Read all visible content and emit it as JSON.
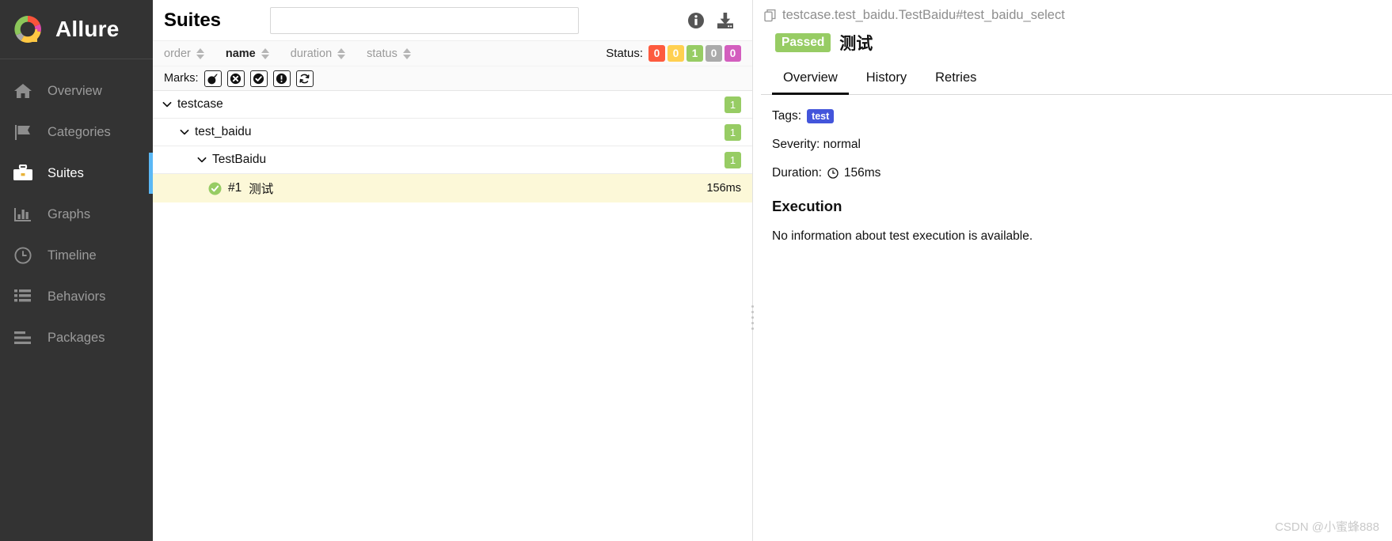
{
  "sidebar": {
    "brand": "Allure",
    "brand_logo_icon": "allure-donut-logo",
    "items": [
      {
        "label": "Overview",
        "icon": "home-icon",
        "active": false
      },
      {
        "label": "Categories",
        "icon": "flag-icon",
        "active": false
      },
      {
        "label": "Suites",
        "icon": "briefcase-icon",
        "active": true
      },
      {
        "label": "Graphs",
        "icon": "bar-chart-icon",
        "active": false
      },
      {
        "label": "Timeline",
        "icon": "clock-icon",
        "active": false
      },
      {
        "label": "Behaviors",
        "icon": "list-icon",
        "active": false
      },
      {
        "label": "Packages",
        "icon": "menu-lines-icon",
        "active": false
      }
    ]
  },
  "center": {
    "title": "Suites",
    "search": {
      "value": "",
      "placeholder": ""
    },
    "header_icons": [
      {
        "name": "info-icon"
      },
      {
        "name": "download-icon"
      }
    ],
    "sort": {
      "columns": [
        {
          "label": "order",
          "active": false
        },
        {
          "label": "name",
          "active": true
        },
        {
          "label": "duration",
          "active": false
        },
        {
          "label": "status",
          "active": false
        }
      ],
      "status_label": "Status:",
      "status_badges": [
        {
          "value": "0",
          "color": "#fd5a3e",
          "name": "failed"
        },
        {
          "value": "0",
          "color": "#ffd050",
          "name": "broken"
        },
        {
          "value": "1",
          "color": "#97cc64",
          "name": "passed"
        },
        {
          "value": "0",
          "color": "#aaaaaa",
          "name": "skipped"
        },
        {
          "value": "0",
          "color": "#d35ebe",
          "name": "unknown"
        }
      ]
    },
    "marks": {
      "label": "Marks:",
      "buttons": [
        {
          "name": "flaky-bomb-icon"
        },
        {
          "name": "failed-x-circle-icon"
        },
        {
          "name": "passed-check-circle-icon"
        },
        {
          "name": "broken-exclamation-circle-icon"
        },
        {
          "name": "retry-refresh-icon"
        }
      ]
    },
    "tree": [
      {
        "level": 1,
        "name": "testcase",
        "count": "1"
      },
      {
        "level": 2,
        "name": "test_baidu",
        "count": "1"
      },
      {
        "level": 3,
        "name": "TestBaidu",
        "count": "1"
      }
    ],
    "leaf": {
      "status_icon": "passed-check-circle-icon",
      "number": "#1",
      "name": "测试",
      "duration": "156ms"
    }
  },
  "detail": {
    "breadcrumb": "testcase.test_baidu.TestBaidu#test_baidu_select",
    "breadcrumb_icon": "copy-icon",
    "status_badge": "Passed",
    "title": "测试",
    "tabs": [
      {
        "label": "Overview",
        "active": true
      },
      {
        "label": "History",
        "active": false
      },
      {
        "label": "Retries",
        "active": false
      }
    ],
    "tags_label": "Tags:",
    "tags": [
      "test"
    ],
    "severity_line": "Severity: normal",
    "duration_label": "Duration:",
    "duration_value": "156ms",
    "duration_icon": "clock-icon",
    "execution_title": "Execution",
    "execution_text": "No information about test execution is available."
  },
  "watermark": "CSDN @小蜜蜂888"
}
